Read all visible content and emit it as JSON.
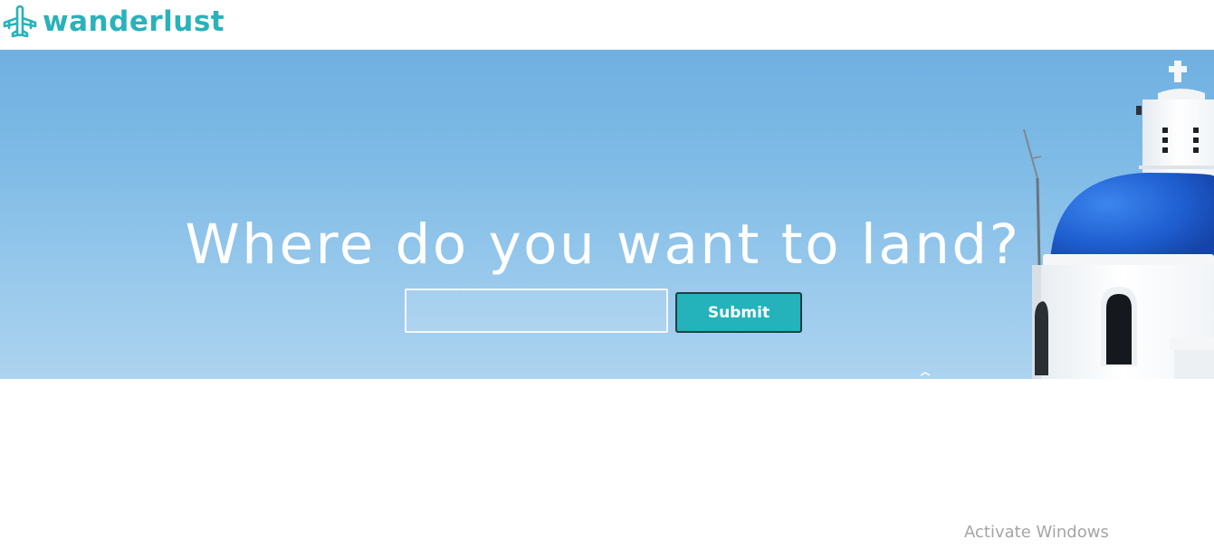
{
  "brand": {
    "name": "wanderlust",
    "icon": "airplane-icon",
    "color": "#2ab2b9"
  },
  "hero": {
    "title": "Where do you want to land?",
    "search": {
      "value": "",
      "placeholder": ""
    },
    "submit_label": "Submit",
    "submit_color": "#24b3ba",
    "sky_color": "#7fbbe6",
    "dome_color": "#1f5fd1"
  },
  "watermark": {
    "text": "Activate Windows"
  }
}
